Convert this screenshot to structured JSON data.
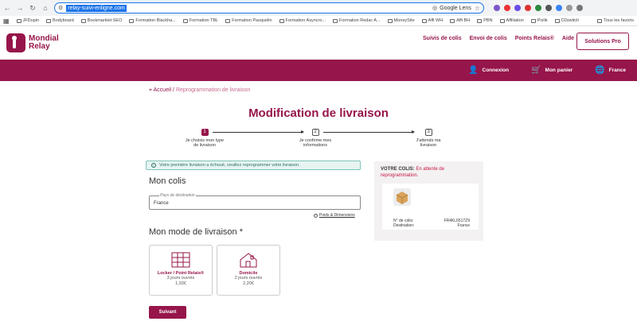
{
  "browser": {
    "url": "relay-suivi-enligne.com",
    "lens_label": "Google Lens",
    "bookmarks": [
      "JFDupin",
      "Bodyboard",
      "Bookmarklet SEO",
      "Formation Blackha...",
      "Formation TBL",
      "Formation Pasquelin",
      "Formation Asyncro...",
      "Formation Redac A...",
      "MoneySite",
      "Affi WH",
      "Affi BH",
      "PBN",
      "Affiliation",
      "Pixlik",
      "O2switch"
    ],
    "all_bookmarks": "Tous les favoris"
  },
  "brand": {
    "name_line1": "Mondial",
    "name_line2": "Relay",
    "color": "#96154a"
  },
  "topnav": [
    "Suivis de colis",
    "Envoi de colis",
    "Points Relais®",
    "Aide"
  ],
  "pro_button": "Solutions Pro",
  "subnav": {
    "login": "Connexion",
    "cart": "Mon panier",
    "country": "France"
  },
  "breadcrumb": {
    "home": "Accueil",
    "sep": "/",
    "current": "Reprogrammation de livraison"
  },
  "page_title": "Modification de livraison",
  "steps": [
    {
      "num": "1",
      "line1": "Je choisis mon type",
      "line2": "de livraison"
    },
    {
      "num": "2",
      "line1": "Je confirme mes",
      "line2": "informations"
    },
    {
      "num": "3",
      "line1": "J'attends ma",
      "line2": "livraison"
    }
  ],
  "alert": "Votre première livraison a échoué, veuillez reprogrammer votre livraison.",
  "mon_colis": {
    "title": "Mon colis",
    "country_label": "Pays de destination",
    "country_value": "France",
    "dims_link": "Poids & Dimensions"
  },
  "delivery": {
    "title": "Mon mode de livraison *",
    "options": [
      {
        "title": "Locker / Point Relais®",
        "delay": "3 jours ouvrés",
        "price": "1,93€"
      },
      {
        "title": "Domicile",
        "delay": "2 jours ouvrés",
        "price": "2,20€"
      }
    ]
  },
  "submit": "Suivant",
  "sidebar": {
    "label": "VOTRE COLIS:",
    "status": "En attente de reprogrammation.",
    "parcel_label": "N° de colis:",
    "parcel_value": "FR4KL6517Z9",
    "dest_label": "Destination:",
    "dest_value": "France"
  }
}
